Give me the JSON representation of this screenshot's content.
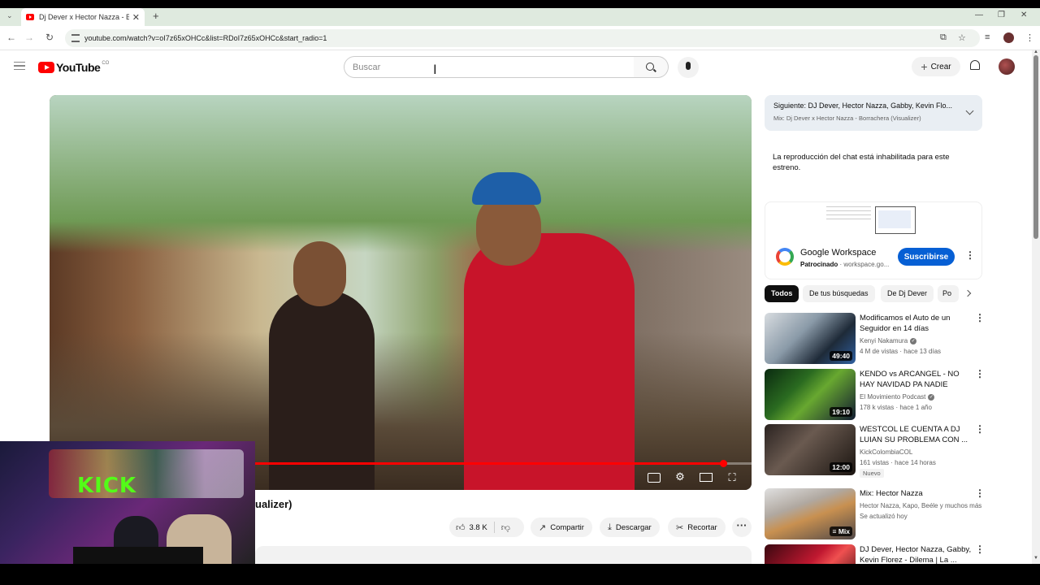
{
  "browser": {
    "tab_title": "Dj Dever x Hector Nazza - Borra",
    "url": "youtube.com/watch?v=oI7z65xOHCc&list=RDoI7z65xOHCc&start_radio=1"
  },
  "youtube": {
    "logo_text": "YouTube",
    "country_code": "CO",
    "search_placeholder": "Buscar",
    "create_label": "Crear"
  },
  "player": {
    "progress_fraction": 0.96
  },
  "video": {
    "title_partial": "ualizer)",
    "likes": "3.8 K",
    "share_label": "Compartir",
    "download_label": "Descargar",
    "clip_label": "Recortar"
  },
  "webcam": {
    "sign_text": "KICK"
  },
  "sidebar": {
    "next_prefix": "Siguiente:",
    "next_title": "DJ Dever, Hector Nazza, Gabby, Kevin Flo...",
    "next_mix": "Mix: Dj Dever x Hector Nazza - Borrachera (Visualizer)",
    "chat_disabled": "La reproducción del chat está inhabilitada para este estreno.",
    "ad": {
      "name": "Google Workspace",
      "sponsored": "Patrocinado",
      "domain": "workspace.go...",
      "subscribe": "Suscribirse"
    },
    "chips": [
      "Todos",
      "De tus búsquedas",
      "De Dj Dever",
      "Po"
    ],
    "recommendations": [
      {
        "title": "Modificamos el Auto de un Seguidor en 14 días",
        "channel": "Kenyi Nakamura",
        "verified": true,
        "meta": "4 M de vistas · hace 13 días",
        "duration": "49:40",
        "badge": ""
      },
      {
        "title": "KENDO vs ARCANGEL - NO HAY NAVIDAD PA NADIE",
        "channel": "El Movimiento Podcast",
        "verified": true,
        "meta": "178 k vistas · hace 1 año",
        "duration": "19:10",
        "badge": ""
      },
      {
        "title": "WESTCOL LE CUENTA A DJ LUIAN SU PROBLEMA CON ...",
        "channel": "KickColombiaCOL",
        "verified": false,
        "meta": "161 vistas · hace 14 horas",
        "duration": "12:00",
        "badge": "Nuevo"
      },
      {
        "title": "Mix: Hector Nazza",
        "channel": "Hector Nazza, Kapo, Beéle y muchos más",
        "verified": false,
        "meta": "Se actualizó hoy",
        "duration": "Mix",
        "badge": ""
      },
      {
        "title": "DJ Dever, Hector Nazza, Gabby, Kevin Florez - Dilema | La ...",
        "channel": "",
        "verified": false,
        "meta": "",
        "duration": "",
        "badge": ""
      }
    ]
  }
}
